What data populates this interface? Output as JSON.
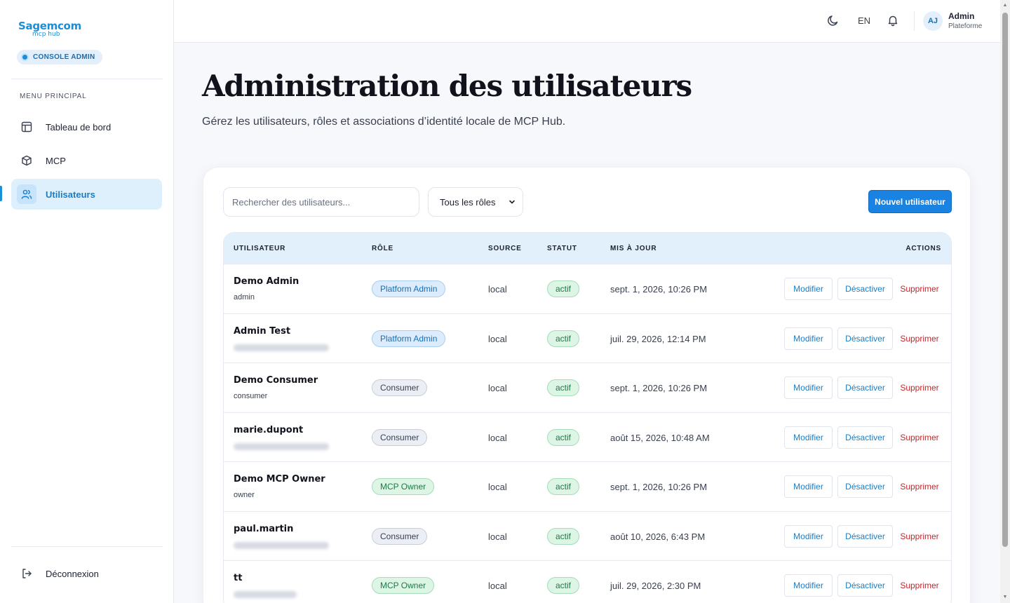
{
  "sidebar": {
    "brand_name": "Sagemcom",
    "brand_sub": "mcp hub",
    "console_badge": "CONSOLE ADMIN",
    "menu_title": "MENU PRINCIPAL",
    "items": [
      {
        "label": "Tableau de bord",
        "icon": "layout-icon"
      },
      {
        "label": "MCP",
        "icon": "cube-icon"
      },
      {
        "label": "Utilisateurs",
        "icon": "users-icon",
        "active": true
      }
    ],
    "logout_label": "Déconnexion"
  },
  "topbar": {
    "language": "EN",
    "avatar_initials": "AJ",
    "user_name": "Admin",
    "user_role": "Plateforme"
  },
  "main": {
    "title": "Administration des utilisateurs",
    "subtitle": "Gérez les utilisateurs, rôles et associations d’identité locale de MCP Hub."
  },
  "toolbar": {
    "search_placeholder": "Rechercher des utilisateurs...",
    "role_filter": "Tous les rôles",
    "new_user_label": "Nouvel utilisateur"
  },
  "table": {
    "headers": {
      "user": "UTILISATEUR",
      "role": "RÔLE",
      "source": "SOURCE",
      "status": "STATUT",
      "updated": "MIS À JOUR",
      "actions": "ACTIONS"
    },
    "action_labels": {
      "modify": "Modifier",
      "disable": "Désactiver",
      "delete": "Supprimer"
    },
    "rows": [
      {
        "name": "Demo Admin",
        "sub": "admin",
        "role": "Platform Admin",
        "source": "local",
        "status": "actif",
        "updated": "sept. 1, 2026, 10:26 PM"
      },
      {
        "name": "Admin Test",
        "sub": "",
        "role": "Platform Admin",
        "source": "local",
        "status": "actif",
        "updated": "juil. 29, 2026, 12:14 PM"
      },
      {
        "name": "Demo Consumer",
        "sub": "consumer",
        "role": "Consumer",
        "source": "local",
        "status": "actif",
        "updated": "sept. 1, 2026, 10:26 PM"
      },
      {
        "name": "marie.dupont",
        "sub": "",
        "role": "Consumer",
        "source": "local",
        "status": "actif",
        "updated": "août 15, 2026, 10:48 AM"
      },
      {
        "name": "Demo MCP Owner",
        "sub": "owner",
        "role": "MCP Owner",
        "source": "local",
        "status": "actif",
        "updated": "sept. 1, 2026, 10:26 PM"
      },
      {
        "name": "paul.martin",
        "sub": "",
        "role": "Consumer",
        "source": "local",
        "status": "actif",
        "updated": "août 10, 2026, 6:43 PM"
      },
      {
        "name": "tt",
        "sub": "",
        "role": "MCP Owner",
        "source": "local",
        "status": "actif",
        "updated": "juil. 29, 2026, 2:30 PM"
      }
    ]
  },
  "colors": {
    "accent": "#1a82e0",
    "danger": "#c0282c",
    "success": "#1f7a45"
  }
}
